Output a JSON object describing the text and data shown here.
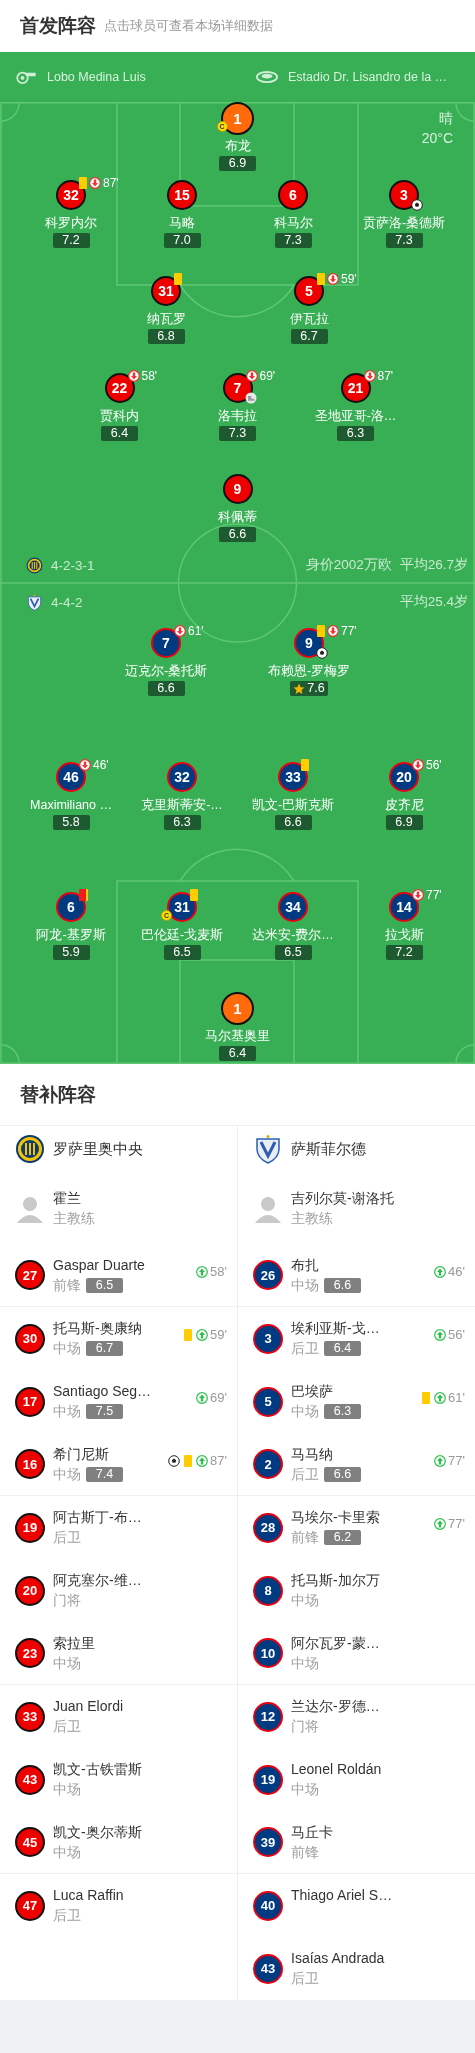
{
  "header": {
    "title": "首发阵容",
    "hint": "点击球员可查看本场详细数据"
  },
  "match_info": {
    "referee": "Lobo Medina Luis",
    "stadium": "Estadio Dr. Lisandro de la …",
    "weather": "晴",
    "temperature": "20°C"
  },
  "home": {
    "formation": "4-2-3-1",
    "market_value": "身价2002万欧",
    "average_age": "平均26.7岁",
    "lines": [
      {
        "players": [
          {
            "number": "1",
            "name": "布龙",
            "rating": "6.9",
            "color": "#ff6a0a",
            "kind": "goalkeeper",
            "events": [
              {
                "kind": "captain",
                "label": "C"
              }
            ]
          }
        ]
      },
      {
        "players": [
          {
            "number": "32",
            "name": "科罗内尔",
            "rating": "7.2",
            "color": "#ee0000",
            "kind": "outfield",
            "events": [
              {
                "kind": "yellow"
              },
              {
                "kind": "sub_off",
                "minute": "87'"
              }
            ]
          },
          {
            "number": "15",
            "name": "马略",
            "rating": "7.0",
            "color": "#ee0000",
            "kind": "outfield"
          },
          {
            "number": "6",
            "name": "科马尔",
            "rating": "7.3",
            "color": "#ee0000",
            "kind": "outfield"
          },
          {
            "number": "3",
            "name": "贡萨洛-桑德斯",
            "rating": "7.3",
            "color": "#ee0000",
            "kind": "outfield",
            "events": [
              {
                "kind": "goal"
              }
            ]
          }
        ]
      },
      {
        "players": [
          {
            "number": "31",
            "name": "纳瓦罗",
            "rating": "6.8",
            "color": "#ee0000",
            "kind": "outfield",
            "events": [
              {
                "kind": "yellow"
              }
            ]
          },
          {
            "number": "5",
            "name": "伊瓦拉",
            "rating": "6.7",
            "color": "#ee0000",
            "kind": "outfield",
            "events": [
              {
                "kind": "yellow"
              },
              {
                "kind": "sub_off",
                "minute": "59'"
              }
            ]
          }
        ]
      },
      {
        "players": [
          {
            "number": "22",
            "name": "贾科内",
            "rating": "6.4",
            "color": "#ee0000",
            "kind": "outfield",
            "events": [
              {
                "kind": "sub_off",
                "minute": "58'"
              }
            ]
          },
          {
            "number": "7",
            "name": "洛韦拉",
            "rating": "7.3",
            "color": "#ee0000",
            "kind": "outfield",
            "events": [
              {
                "kind": "sub_off",
                "minute": "69'"
              },
              {
                "kind": "assist"
              }
            ]
          },
          {
            "number": "21",
            "name": "圣地亚哥-洛…",
            "rating": "6.3",
            "color": "#ee0000",
            "kind": "outfield",
            "events": [
              {
                "kind": "sub_off",
                "minute": "87'"
              }
            ]
          }
        ]
      },
      {
        "players": [
          {
            "number": "9",
            "name": "科佩蒂",
            "rating": "6.6",
            "color": "#ee0000",
            "kind": "outfield"
          }
        ]
      }
    ]
  },
  "away": {
    "formation": "4-4-2",
    "average_age": "平均25.4岁",
    "lines": [
      {
        "players": [
          {
            "number": "7",
            "name": "迈克尔-桑托斯",
            "rating": "6.6",
            "color": "#003a80",
            "kind": "outfield",
            "events": [
              {
                "kind": "sub_off",
                "minute": "61'"
              }
            ]
          },
          {
            "number": "9",
            "name": "布赖恩-罗梅罗",
            "rating": "7.6",
            "color": "#003a80",
            "kind": "outfield",
            "best": true,
            "events": [
              {
                "kind": "yellow"
              },
              {
                "kind": "sub_off",
                "minute": "77'"
              },
              {
                "kind": "goal"
              }
            ]
          }
        ]
      },
      {
        "players": [
          {
            "number": "46",
            "name": "Maximiliano …",
            "rating": "5.8",
            "color": "#003a80",
            "kind": "outfield",
            "events": [
              {
                "kind": "sub_off",
                "minute": "46'"
              }
            ]
          },
          {
            "number": "32",
            "name": "克里斯蒂安-…",
            "rating": "6.3",
            "color": "#003a80",
            "kind": "outfield"
          },
          {
            "number": "33",
            "name": "凯文-巴斯克斯",
            "rating": "6.6",
            "color": "#003a80",
            "kind": "outfield",
            "events": [
              {
                "kind": "yellow"
              }
            ]
          },
          {
            "number": "20",
            "name": "皮齐尼",
            "rating": "6.9",
            "color": "#003a80",
            "kind": "outfield",
            "events": [
              {
                "kind": "sub_off",
                "minute": "56'"
              }
            ]
          }
        ]
      },
      {
        "players": [
          {
            "number": "6",
            "name": "阿龙-基罗斯",
            "rating": "5.9",
            "color": "#003a80",
            "kind": "outfield",
            "events": [
              {
                "kind": "red"
              }
            ]
          },
          {
            "number": "31",
            "name": "巴伦廷-戈麦斯",
            "rating": "6.5",
            "color": "#003a80",
            "kind": "outfield",
            "events": [
              {
                "kind": "yellow"
              },
              {
                "kind": "captain",
                "label": "C"
              }
            ]
          },
          {
            "number": "34",
            "name": "达米安-费尔…",
            "rating": "6.5",
            "color": "#003a80",
            "kind": "outfield"
          },
          {
            "number": "14",
            "name": "拉戈斯",
            "rating": "7.2",
            "color": "#003a80",
            "kind": "outfield",
            "events": [
              {
                "kind": "sub_off",
                "minute": "77'"
              }
            ]
          }
        ]
      },
      {
        "players": [
          {
            "number": "1",
            "name": "马尔基奥里",
            "rating": "6.4",
            "color": "#ff6a0a",
            "kind": "goalkeeper"
          }
        ]
      }
    ]
  },
  "substitutes": {
    "title": "替补阵容",
    "teams": [
      {
        "name": "罗萨里奥中央",
        "color": "#ee0000",
        "coach": {
          "name": "霍兰",
          "role": "主教练"
        },
        "players": [
          {
            "number": "27",
            "name": "Gaspar Duarte",
            "position": "前锋",
            "rating": "6.5",
            "events": [
              {
                "kind": "sub_on",
                "minute": "58'"
              }
            ]
          },
          {
            "number": "30",
            "name": "托马斯-奥康纳",
            "position": "中场",
            "rating": "6.7",
            "events": [
              {
                "kind": "yellow"
              },
              {
                "kind": "sub_on",
                "minute": "59'"
              }
            ]
          },
          {
            "number": "17",
            "name": "Santiago Seg…",
            "position": "中场",
            "rating": "7.5",
            "events": [
              {
                "kind": "sub_on",
                "minute": "69'"
              }
            ]
          },
          {
            "number": "16",
            "name": "希门尼斯",
            "position": "中场",
            "rating": "7.4",
            "events": [
              {
                "kind": "goal"
              },
              {
                "kind": "yellow"
              },
              {
                "kind": "sub_on",
                "minute": "87'"
              }
            ]
          },
          {
            "number": "19",
            "name": "阿古斯丁-布…",
            "position": "后卫"
          },
          {
            "number": "20",
            "name": "阿克塞尔-维…",
            "position": "门将"
          },
          {
            "number": "23",
            "name": "索拉里",
            "position": "中场"
          },
          {
            "number": "33",
            "name": "Juan Elordi",
            "position": "后卫"
          },
          {
            "number": "43",
            "name": "凯文-古铁雷斯",
            "position": "中场"
          },
          {
            "number": "45",
            "name": "凯文-奥尔蒂斯",
            "position": "中场"
          },
          {
            "number": "47",
            "name": "Luca Raffin",
            "position": "后卫"
          }
        ]
      },
      {
        "name": "萨斯菲尔德",
        "color": "#003a80",
        "coach": {
          "name": "吉列尔莫-谢洛托",
          "role": "主教练"
        },
        "players": [
          {
            "number": "26",
            "name": "布扎",
            "position": "中场",
            "rating": "6.6",
            "events": [
              {
                "kind": "sub_on",
                "minute": "46'"
              }
            ]
          },
          {
            "number": "3",
            "name": "埃利亚斯-戈…",
            "position": "后卫",
            "rating": "6.4",
            "events": [
              {
                "kind": "sub_on",
                "minute": "56'"
              }
            ]
          },
          {
            "number": "5",
            "name": "巴埃萨",
            "position": "中场",
            "rating": "6.3",
            "events": [
              {
                "kind": "yellow"
              },
              {
                "kind": "sub_on",
                "minute": "61'"
              }
            ]
          },
          {
            "number": "2",
            "name": "马马纳",
            "position": "后卫",
            "rating": "6.6",
            "events": [
              {
                "kind": "sub_on",
                "minute": "77'"
              }
            ]
          },
          {
            "number": "28",
            "name": "马埃尔-卡里索",
            "position": "前锋",
            "rating": "6.2",
            "events": [
              {
                "kind": "sub_on",
                "minute": "77'"
              }
            ]
          },
          {
            "number": "8",
            "name": "托马斯-加尔万",
            "position": "中场"
          },
          {
            "number": "10",
            "name": "阿尔瓦罗-蒙…",
            "position": "中场"
          },
          {
            "number": "12",
            "name": "兰达尔-罗德…",
            "position": "门将"
          },
          {
            "number": "19",
            "name": "Leonel Roldán",
            "position": "中场"
          },
          {
            "number": "39",
            "name": "马丘卡",
            "position": "前锋"
          },
          {
            "number": "40",
            "name": "Thiago Ariel S…"
          },
          {
            "number": "43",
            "name": "Isaías Andrada",
            "position": "后卫"
          }
        ]
      }
    ]
  }
}
